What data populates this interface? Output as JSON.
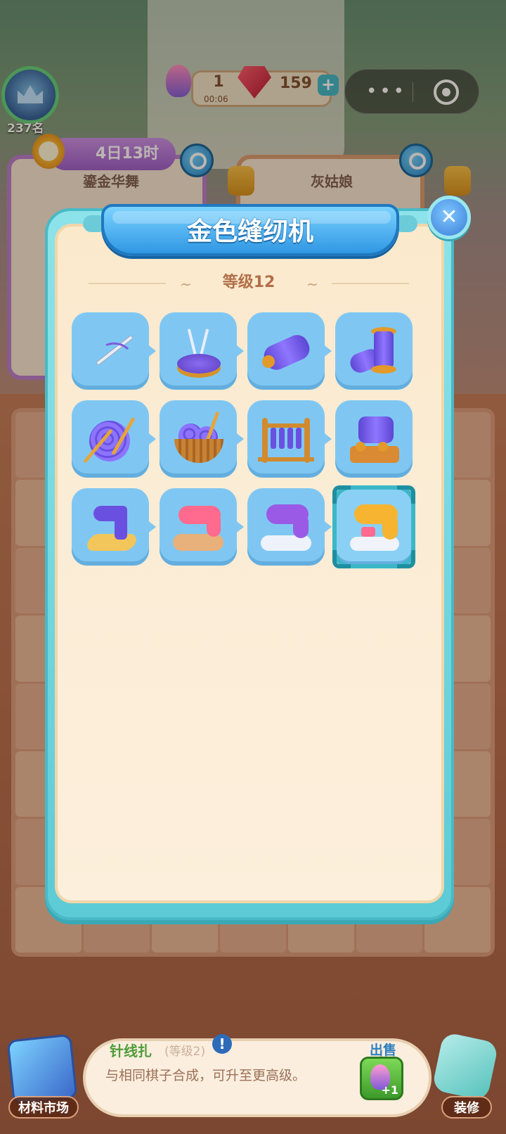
{
  "hud": {
    "rank_text": "237名",
    "level": "1",
    "level_timer": "00:06",
    "gems": "159",
    "plus_label": "+",
    "event_timer": "4日13时"
  },
  "background_cards": [
    {
      "title": "鎏金华舞"
    },
    {
      "title": "灰姑娘"
    }
  ],
  "modal": {
    "title": "金色缝纫机",
    "level_label": "等级12",
    "close_label": "✕",
    "items": [
      {
        "icon": "needle-thread-icon",
        "selected": false
      },
      {
        "icon": "pin-cushion-icon",
        "selected": false
      },
      {
        "icon": "thread-spool-icon",
        "selected": false
      },
      {
        "icon": "double-spool-icon",
        "selected": false
      },
      {
        "icon": "yarn-ball-icon",
        "selected": false
      },
      {
        "icon": "yarn-basket-icon",
        "selected": false
      },
      {
        "icon": "thread-rack-icon",
        "selected": false
      },
      {
        "icon": "spool-winder-icon",
        "selected": false
      },
      {
        "icon": "treadle-sewing-machine-icon",
        "selected": false
      },
      {
        "icon": "pink-sewing-machine-icon",
        "selected": false
      },
      {
        "icon": "purple-sewing-machine-icon",
        "selected": false
      },
      {
        "icon": "golden-sewing-machine-icon",
        "selected": true
      }
    ]
  },
  "bottom": {
    "market_label": "材料市场",
    "decor_label": "装修",
    "item_name": "针线扎",
    "item_level": "(等级2)",
    "alert": "!",
    "description": "与相同棋子合成，可升至更高级。",
    "sell_label": "出售",
    "sell_reward": "+1"
  },
  "colors": {
    "modal_border": "#5ccbd6",
    "title_ribbon": "#2f97e3",
    "tile": "#7fc7f2",
    "selected_outline": "#3bb7c7"
  }
}
